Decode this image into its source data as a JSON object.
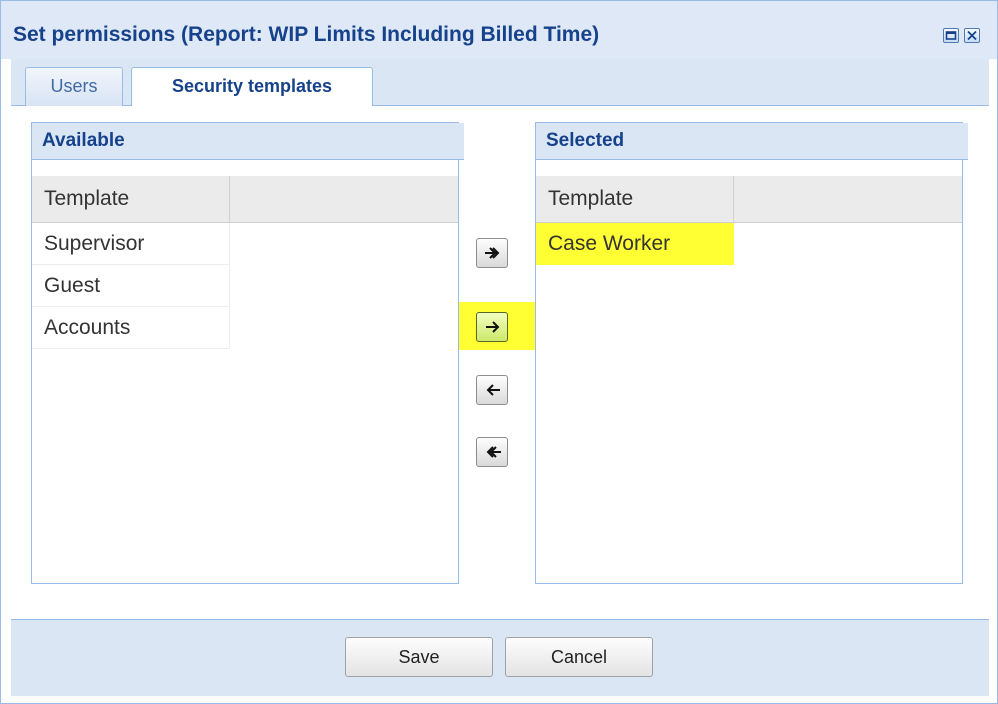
{
  "window": {
    "title": "Set permissions (Report: WIP Limits Including Billed Time)",
    "tools": [
      "maximize-icon",
      "close-icon"
    ]
  },
  "tabs": [
    {
      "label": "Users",
      "active": false
    },
    {
      "label": "Security templates",
      "active": true
    }
  ],
  "available": {
    "title": "Available",
    "column": "Template",
    "rows": [
      "Supervisor",
      "Guest",
      "Accounts"
    ]
  },
  "selected": {
    "title": "Selected",
    "column": "Template",
    "rows": [
      "Case Worker"
    ],
    "highlighted_row": "Case Worker"
  },
  "movers": [
    {
      "name": "move-all-right",
      "icon": "double-arrow-right-icon"
    },
    {
      "name": "move-right",
      "icon": "arrow-right-icon",
      "highlighted": true
    },
    {
      "name": "move-left",
      "icon": "arrow-left-icon"
    },
    {
      "name": "move-all-left",
      "icon": "double-arrow-left-icon"
    }
  ],
  "footer": {
    "save_label": "Save",
    "cancel_label": "Cancel"
  },
  "colors": {
    "header_text": "#15428b",
    "panel_border": "#99bbe8",
    "highlight": "#ffff33"
  }
}
